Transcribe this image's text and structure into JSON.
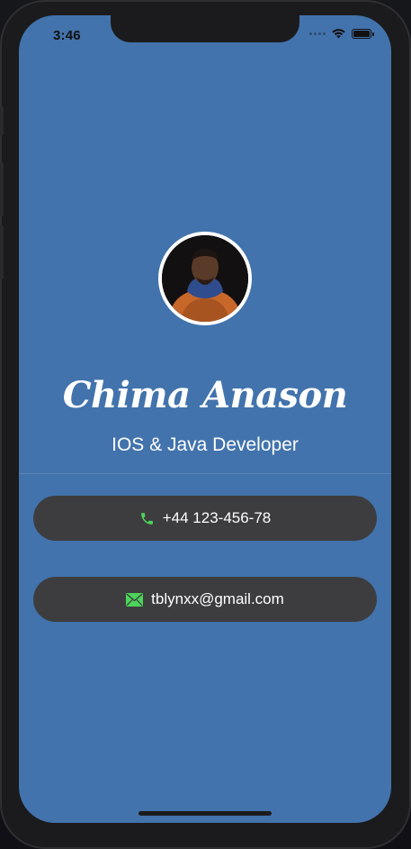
{
  "status_bar": {
    "time": "3:46"
  },
  "profile": {
    "name": "Chima Anason",
    "title": "IOS & Java Developer"
  },
  "contacts": [
    {
      "icon": "phone-icon",
      "text": "+44 123-456-78"
    },
    {
      "icon": "envelope-icon",
      "text": "tblynxx@gmail.com"
    }
  ],
  "colors": {
    "screen_background": "#4273ac",
    "pill_background": "#3d3d3f",
    "icon_accent": "#4cd35a"
  }
}
